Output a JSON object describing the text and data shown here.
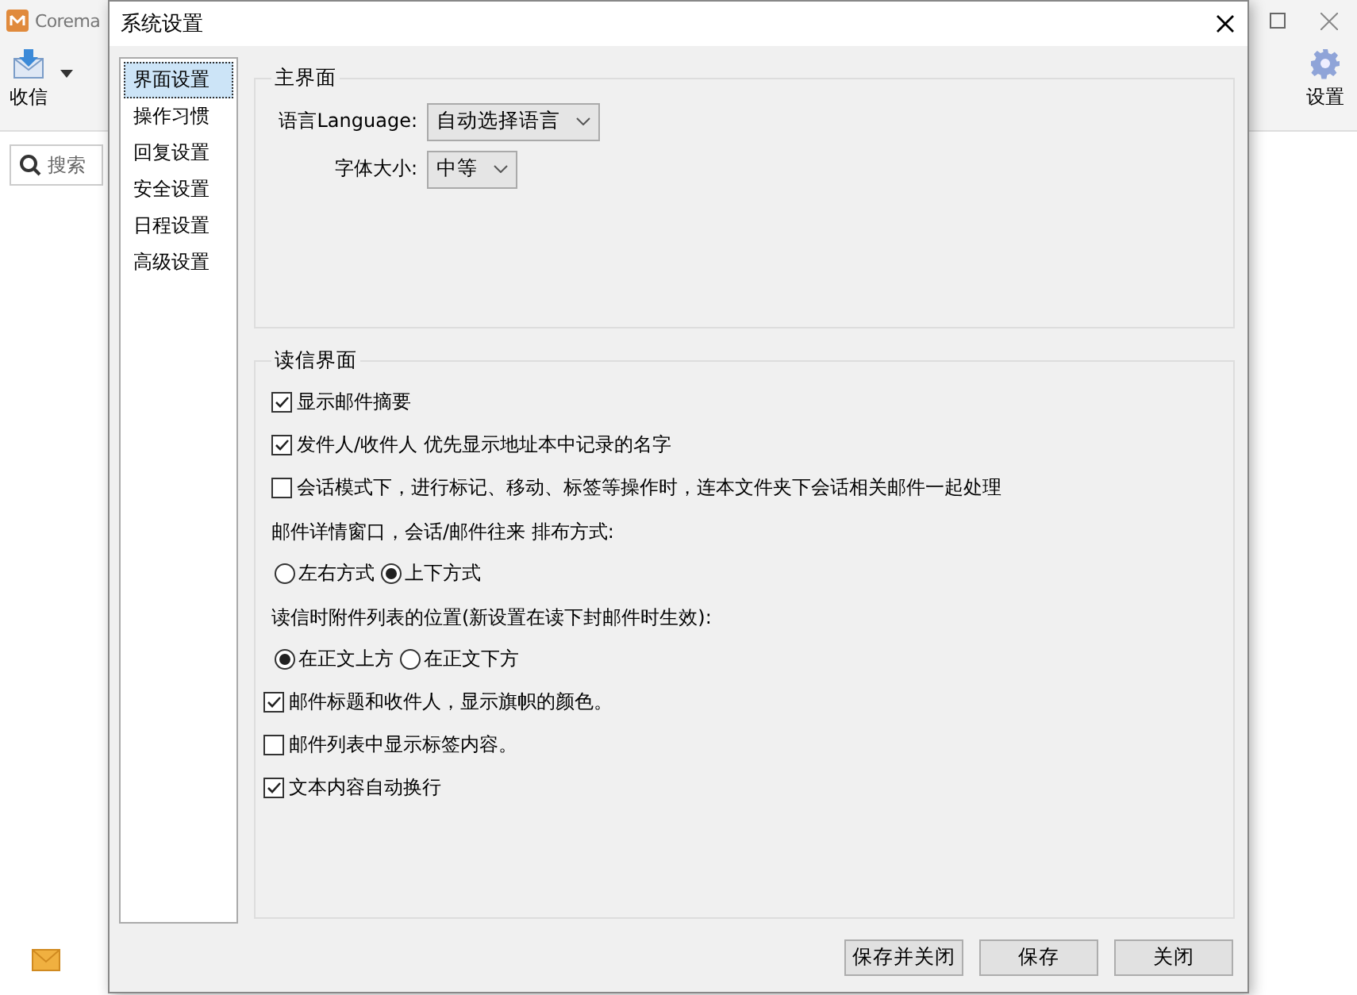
{
  "background_app": {
    "title": "Corema",
    "toolbar": [
      {
        "kind": "receive",
        "label": "收信"
      },
      {
        "kind": "settings",
        "label": "设置"
      }
    ],
    "search": {
      "placeholder": "搜索"
    }
  },
  "dialog": {
    "title": "系统设置",
    "sidebar": {
      "items": [
        {
          "label": "界面设置",
          "selected": true
        },
        {
          "label": "操作习惯",
          "selected": false
        },
        {
          "label": "回复设置",
          "selected": false
        },
        {
          "label": "安全设置",
          "selected": false
        },
        {
          "label": "日程设置",
          "selected": false
        },
        {
          "label": "高级设置",
          "selected": false
        }
      ]
    },
    "main_group": {
      "title": "主界面",
      "fields": [
        {
          "label": "语言Language:",
          "value": "自动选择语言"
        },
        {
          "label": "字体大小:",
          "value": "中等"
        }
      ]
    },
    "reading_group": {
      "title": "读信界面",
      "items": [
        {
          "kind": "checkbox",
          "label": "显示邮件摘要",
          "checked": true
        },
        {
          "kind": "checkbox",
          "label": "发件人/收件人 优先显示地址本中记录的名字",
          "checked": true
        },
        {
          "kind": "checkbox",
          "label": "会话模式下，进行标记、移动、标签等操作时，连本文件夹下会话相关邮件一起处理",
          "checked": false
        },
        {
          "kind": "label",
          "label": "邮件详情窗口，会话/邮件往来 排布方式:"
        },
        {
          "kind": "radios",
          "options": [
            {
              "label": "左右方式",
              "selected": false
            },
            {
              "label": "上下方式",
              "selected": true
            }
          ]
        },
        {
          "kind": "label",
          "label": "读信时附件列表的位置(新设置在读下封邮件时生效):"
        },
        {
          "kind": "radios",
          "options": [
            {
              "label": "在正文上方",
              "selected": true
            },
            {
              "label": "在正文下方",
              "selected": false
            }
          ]
        },
        {
          "kind": "checkbox",
          "label": "邮件标题和收件人，显示旗帜的颜色。",
          "checked": true
        },
        {
          "kind": "checkbox",
          "label": "邮件列表中显示标签内容。",
          "checked": false
        },
        {
          "kind": "checkbox",
          "label": "文本内容自动换行",
          "checked": true
        }
      ]
    },
    "buttons": [
      "保存并关闭",
      "保存",
      "关闭"
    ]
  }
}
